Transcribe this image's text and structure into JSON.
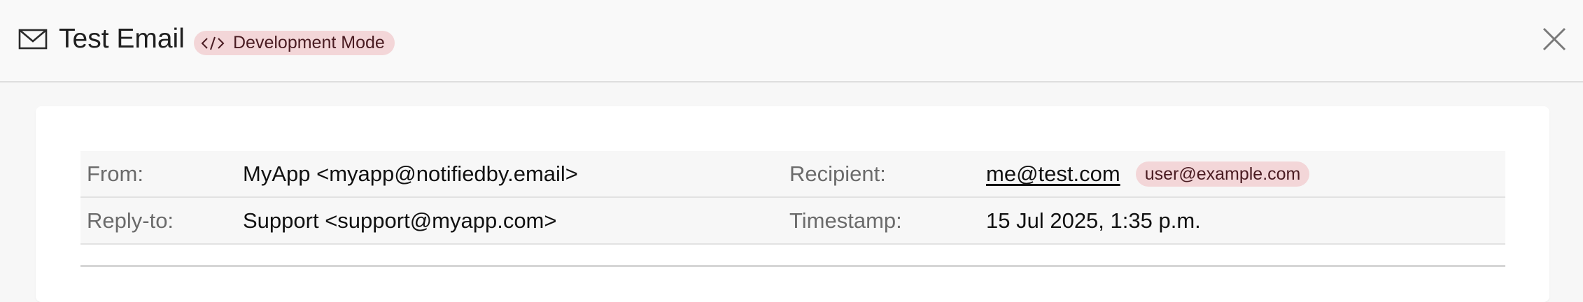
{
  "header": {
    "title": "Test Email",
    "mode_badge": "Development Mode",
    "icons": {
      "mail": "envelope-icon",
      "code": "code-icon",
      "close": "close-icon"
    }
  },
  "email": {
    "from_label": "From:",
    "from_value": "MyApp <myapp@notifiedby.email>",
    "reply_to_label": "Reply-to:",
    "reply_to_value": "Support <support@myapp.com>",
    "recipient_label": "Recipient:",
    "recipient_value": "me@test.com",
    "recipient_badge": "user@example.com",
    "timestamp_label": "Timestamp:",
    "timestamp_value": "15 Jul 2025, 1:35 p.m."
  },
  "colors": {
    "badge_bg": "#f3d6d8",
    "badge_text": "#4a1c22",
    "label_text": "#6b6b6b",
    "row_bg": "#f7f7f7"
  }
}
